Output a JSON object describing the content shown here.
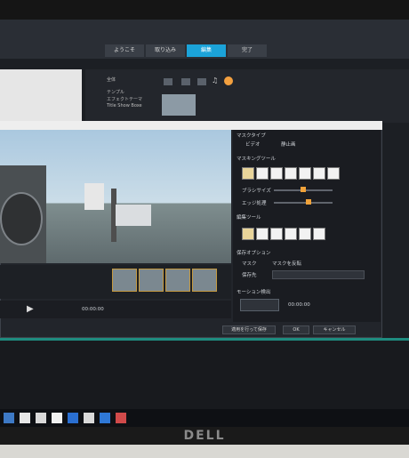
{
  "tabs": [
    "ようこそ",
    "取り込み",
    "編集",
    "完了"
  ],
  "active_tab": "編集",
  "left_panel_items": [
    "全体",
    "テンプル",
    "エフェクトテーマ",
    "Title Show Boxe"
  ],
  "dialog": {
    "mask_type_label": "マスクタイプ",
    "mask_type_options": [
      "ビデオ",
      "静止画"
    ],
    "masking_tool_label": "マスキングツール",
    "brush_size_label": "ブラシサイズ",
    "edge_smooth_label": "エッジ処理",
    "edit_tool_label": "編集ツール",
    "save_option_label": "保存オプション",
    "save_option_radio": [
      "マスク",
      "マスクを反転"
    ],
    "save_location_label": "保存先",
    "motion_detect_label": "モーション検出",
    "timecode_left": "00:00:00",
    "timecode_right": "00:00:00",
    "footer_apply": "適用を行って保存",
    "footer_ok": "OK",
    "footer_cancel": "キャンセル"
  },
  "brand": "DELL"
}
